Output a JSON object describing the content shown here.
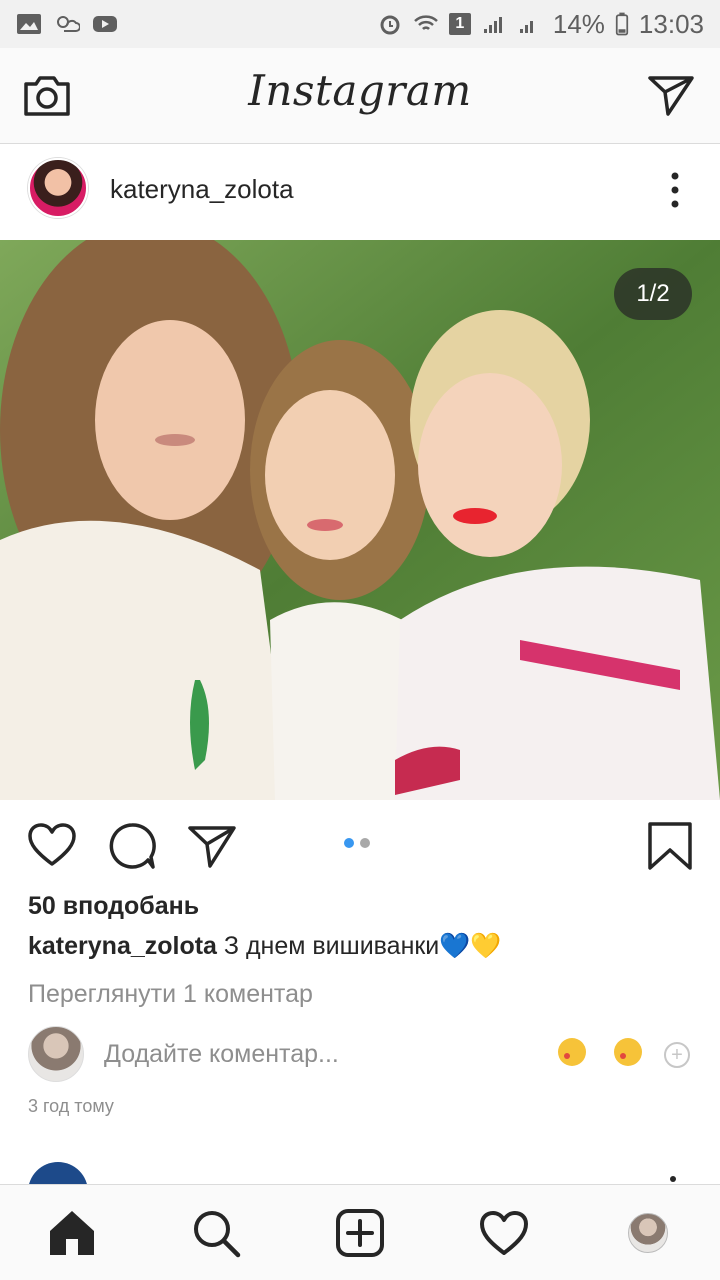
{
  "status_bar": {
    "battery": "14%",
    "time": "13:03",
    "sim_badge": "1"
  },
  "header": {
    "app_title": "Instagram"
  },
  "post": {
    "username": "kateryna_zolota",
    "image_counter": "1/2",
    "likes": "50 вподобань",
    "caption_user": "kateryna_zolota",
    "caption_text": " З днем вишиванки💙💛",
    "view_comments": "Переглянути 1 коментар",
    "comment_placeholder": "Додайте коментар...",
    "timestamp": "3 год тому",
    "carousel": {
      "total": 2,
      "current": 1
    }
  },
  "colors": {
    "accent": "#3897f0",
    "text": "#262626",
    "muted": "#8e8e8e"
  }
}
